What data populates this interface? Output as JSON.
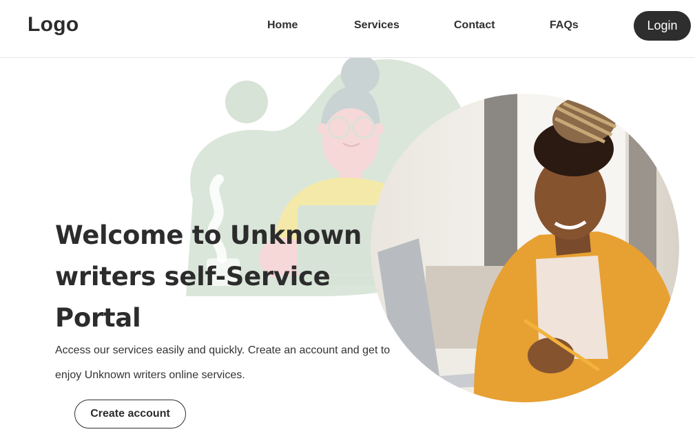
{
  "header": {
    "logo": "Logo",
    "nav": {
      "home": "Home",
      "services": "Services",
      "contact": "Contact",
      "faqs": "FAQs"
    },
    "login_label": "Login"
  },
  "hero": {
    "title": "Welcome to Unknown writers self-Service Portal",
    "subtitle": "Access our services easily and quickly. Create an account and get to enjoy Unknown writers online services.",
    "cta_label": "Create account"
  },
  "colors": {
    "dark": "#2e2e2e",
    "blob_green": "#d8e4d8",
    "shirt_yellow": "#f4e9a8",
    "skin_pink": "#f6d8d8",
    "jacket_orange": "#e7a032"
  },
  "icons": {
    "illustration": "woman-with-laptop-illustration",
    "photo": "smiling-woman-writing-photo"
  }
}
